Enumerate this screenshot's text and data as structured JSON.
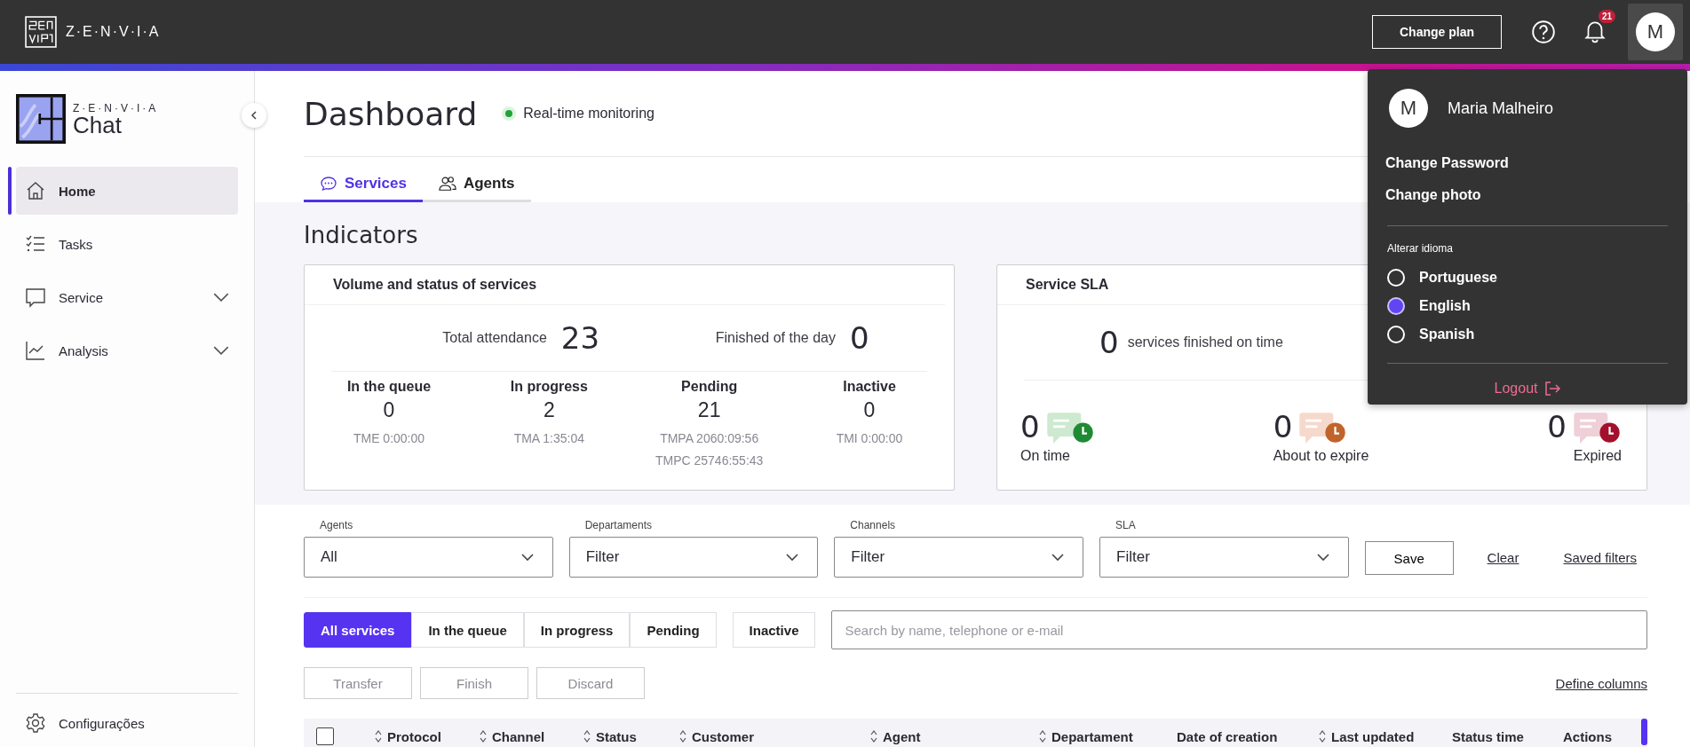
{
  "topbar": {
    "brand": "Z·E·N·V·I·A",
    "change_plan": "Change plan",
    "notification_count": "21",
    "avatar": "M"
  },
  "sidebar": {
    "brand": "Z·E·N·V·I·A",
    "product": "Chat",
    "items": [
      {
        "label": "Home",
        "kind": "link",
        "selected": true
      },
      {
        "label": "Tasks",
        "kind": "link",
        "selected": false
      },
      {
        "label": "Service",
        "kind": "group",
        "selected": false
      },
      {
        "label": "Analysis",
        "kind": "group",
        "selected": false
      }
    ],
    "footer": "Configurações"
  },
  "header": {
    "title": "Dashboard",
    "status": "Real-time monitoring",
    "tabs": [
      {
        "label": "Services",
        "selected": true
      },
      {
        "label": "Agents",
        "selected": false
      }
    ]
  },
  "indicators": {
    "title": "Indicators",
    "volume": {
      "title": "Volume and status of services",
      "summary": [
        {
          "label": "Total attendance",
          "value": "23"
        },
        {
          "label": "Finished of the day",
          "value": "0"
        }
      ],
      "statuses": [
        {
          "label": "In the queue",
          "value": "0",
          "times": [
            "TME 0:00:00"
          ]
        },
        {
          "label": "In progress",
          "value": "2",
          "times": [
            "TMA 1:35:04"
          ]
        },
        {
          "label": "Pending",
          "value": "21",
          "times": [
            "TMPA 2060:09:56",
            "TMPC 25746:55:43"
          ]
        },
        {
          "label": "Inactive",
          "value": "0",
          "times": [
            "TMI 0:00:00"
          ]
        }
      ]
    },
    "sla": {
      "title": "Service SLA",
      "value": "0",
      "label": "services finished on time",
      "items": [
        {
          "kind": "on_time",
          "value": "0",
          "label": "On time"
        },
        {
          "kind": "about_to_expire",
          "value": "0",
          "label": "About to expire"
        },
        {
          "kind": "expired",
          "value": "0",
          "label": "Expired"
        }
      ]
    }
  },
  "filters": [
    {
      "label": "Agents",
      "value": "All"
    },
    {
      "label": "Departaments",
      "value": "Filter"
    },
    {
      "label": "Channels",
      "value": "Filter"
    },
    {
      "label": "SLA",
      "value": "Filter"
    }
  ],
  "filter_actions": {
    "save": "Save",
    "clear": "Clear",
    "saved_filters": "Saved filters"
  },
  "segments": [
    {
      "label": "All services",
      "selected": true
    },
    {
      "label": "In the queue",
      "selected": false
    },
    {
      "label": "In progress",
      "selected": false
    },
    {
      "label": "Pending",
      "selected": false
    }
  ],
  "inactive": "Inactive",
  "search": {
    "placeholder": "Search by name, telephone or e-mail"
  },
  "actions": [
    {
      "label": "Transfer",
      "disabled": true
    },
    {
      "label": "Finish",
      "disabled": true
    },
    {
      "label": "Discard",
      "disabled": true
    }
  ],
  "define_columns": "Define columns",
  "table": {
    "select_all": {
      "checked": false
    },
    "columns": [
      {
        "label": "Protocol",
        "sortable": true
      },
      {
        "label": "Channel",
        "sortable": true
      },
      {
        "label": "Status",
        "sortable": true
      },
      {
        "label": "Customer",
        "sortable": true
      },
      {
        "label": "Agent",
        "sortable": true
      },
      {
        "label": "Departament",
        "sortable": true
      },
      {
        "label": "Date of creation",
        "sortable": false
      },
      {
        "label": "Last updated",
        "sortable": true
      },
      {
        "label": "Status time",
        "sortable": false
      },
      {
        "label": "Actions",
        "sortable": false
      }
    ]
  },
  "user_menu": {
    "avatar": "M",
    "name": "Maria Malheiro",
    "links": [
      "Change Password",
      "Change photo"
    ],
    "language_title": "Alterar idioma",
    "languages": [
      {
        "label": "Portuguese",
        "selected": false
      },
      {
        "label": "English",
        "selected": true
      },
      {
        "label": "Spanish",
        "selected": false
      }
    ],
    "logout": "Logout"
  }
}
